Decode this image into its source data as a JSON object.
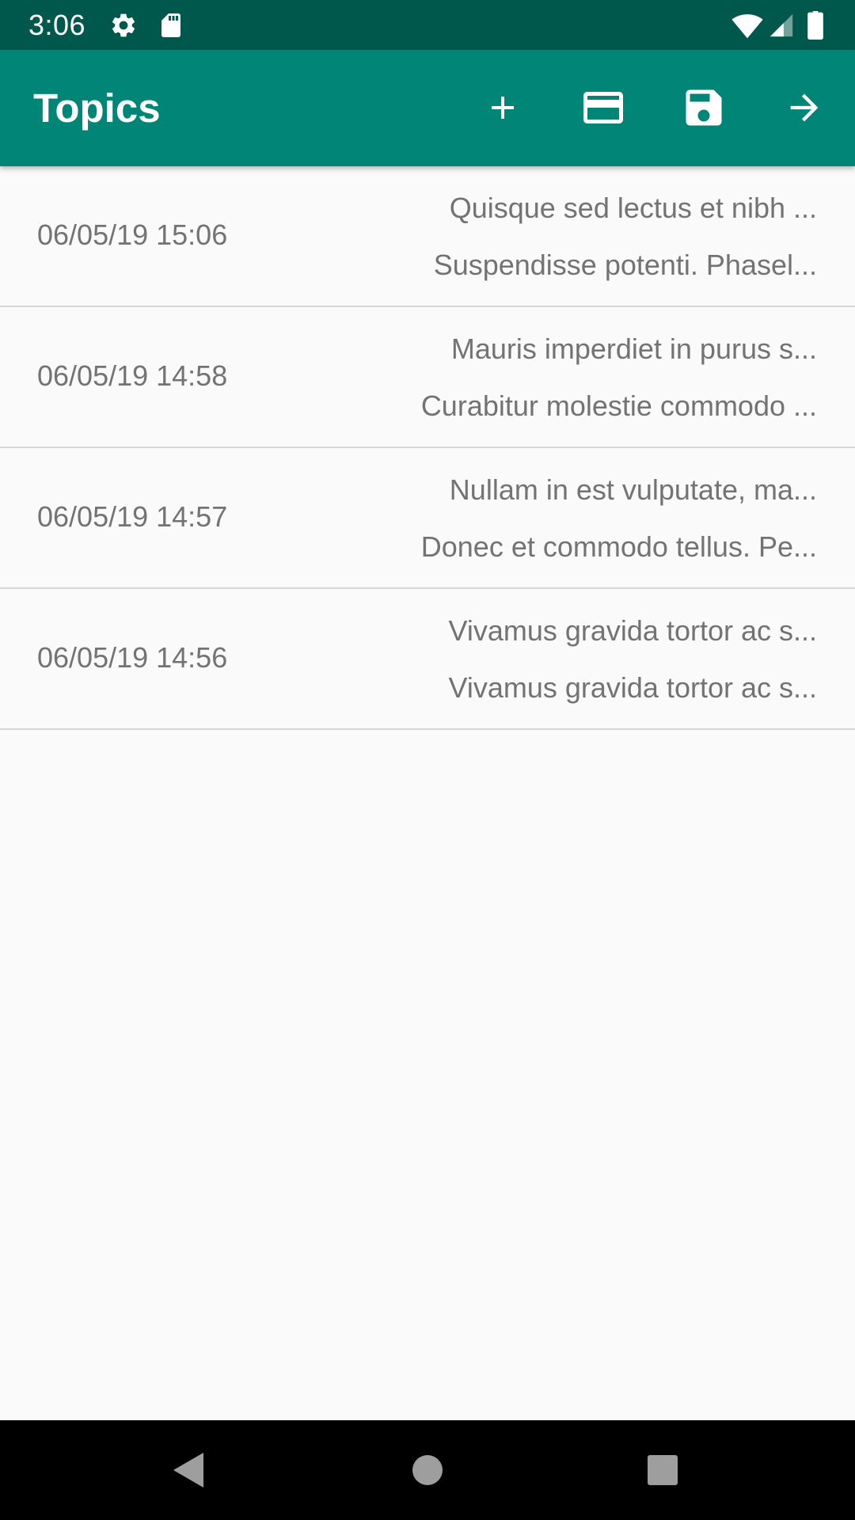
{
  "status_bar": {
    "time": "3:06",
    "icons": [
      "gear-icon",
      "sd-card-icon",
      "wifi-icon",
      "signal-icon",
      "battery-icon"
    ],
    "background": "#00574b"
  },
  "app_bar": {
    "title": "Topics",
    "background": "#008577",
    "actions": [
      {
        "name": "add",
        "icon": "plus-icon"
      },
      {
        "name": "card",
        "icon": "credit-card-icon"
      },
      {
        "name": "save",
        "icon": "floppy-disk-icon"
      },
      {
        "name": "next",
        "icon": "arrow-right-icon"
      }
    ]
  },
  "topics": [
    {
      "date": "06/05/19 15:06",
      "line1": "Quisque sed lectus et nibh ...",
      "line2": "Suspendisse potenti. Phasel..."
    },
    {
      "date": "06/05/19 14:58",
      "line1": "Mauris imperdiet in purus s...",
      "line2": "Curabitur molestie commodo ..."
    },
    {
      "date": "06/05/19 14:57",
      "line1": "Nullam in est vulputate, ma...",
      "line2": "Donec et commodo tellus. Pe..."
    },
    {
      "date": "06/05/19 14:56",
      "line1": "Vivamus gravida tortor ac s...",
      "line2": "Vivamus gravida tortor ac s..."
    }
  ],
  "nav_bar": {
    "buttons": [
      "back-icon",
      "home-icon",
      "recents-icon"
    ]
  }
}
